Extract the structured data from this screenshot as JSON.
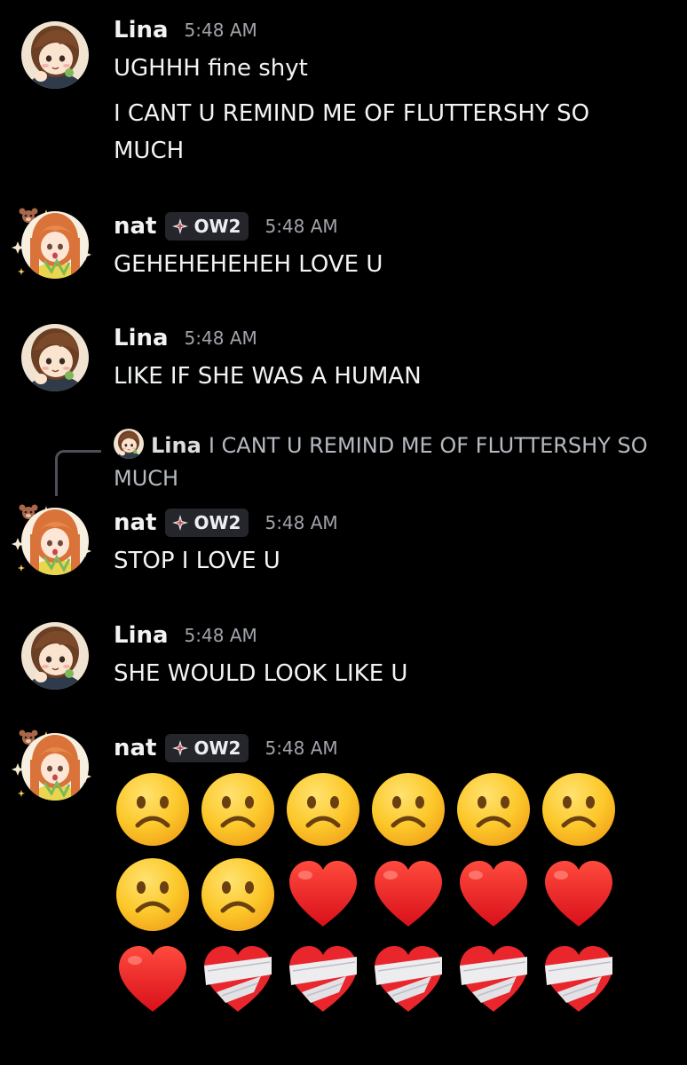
{
  "colors": {
    "background": "#000000",
    "username": "#f2f3f5",
    "timestamp": "#a1a3aa",
    "tag_background": "#25262b",
    "reply_text": "#b5bac1"
  },
  "messages": [
    {
      "author": "Lina",
      "time": "5:48 AM",
      "lines": [
        "UGHHH fine shyt",
        "I CANT U REMIND ME OF FLUTTERSHY SO MUCH"
      ]
    },
    {
      "author": "nat",
      "tag": "OW2",
      "time": "5:48 AM",
      "lines": [
        "GEHEHEHEHEH LOVE U"
      ]
    },
    {
      "author": "Lina",
      "time": "5:48 AM",
      "lines": [
        "LIKE IF SHE WAS A HUMAN"
      ]
    },
    {
      "author": "nat",
      "tag": "OW2",
      "time": "5:48 AM",
      "reply": {
        "author": "Lina",
        "text": "I CANT U REMIND ME OF FLUTTERSHY SO MUCH"
      },
      "lines": [
        "STOP I LOVE U"
      ]
    },
    {
      "author": "Lina",
      "time": "5:48 AM",
      "lines": [
        "SHE WOULD LOOK LIKE U"
      ]
    },
    {
      "author": "nat",
      "tag": "OW2",
      "time": "5:48 AM",
      "emoji_rows": [
        [
          "frowning-face",
          "frowning-face",
          "frowning-face",
          "frowning-face",
          "frowning-face",
          "frowning-face"
        ],
        [
          "frowning-face",
          "frowning-face",
          "red-heart",
          "red-heart",
          "red-heart",
          "red-heart"
        ],
        [
          "red-heart",
          "mending-heart",
          "mending-heart",
          "mending-heart",
          "mending-heart",
          "mending-heart"
        ]
      ]
    }
  ]
}
